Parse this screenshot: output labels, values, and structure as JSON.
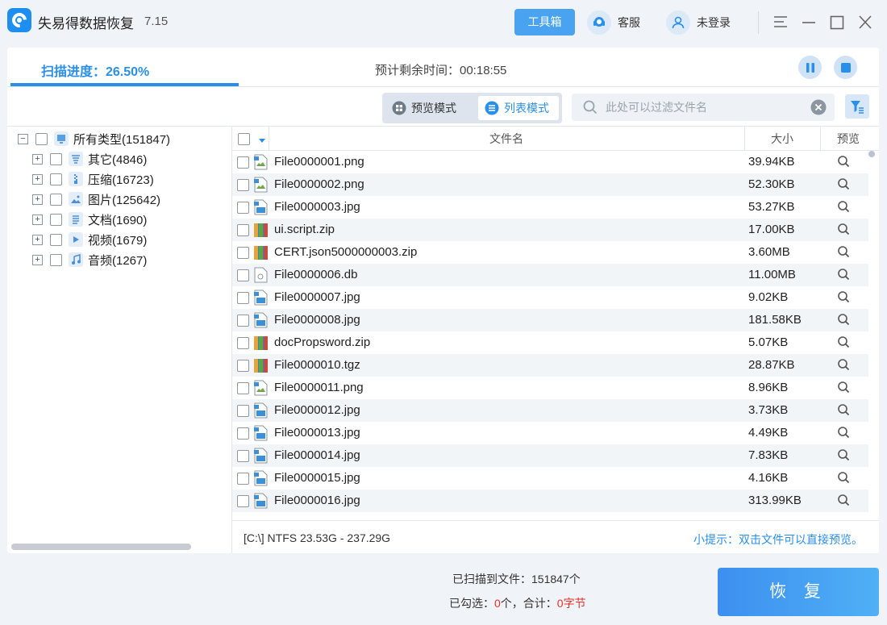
{
  "app": {
    "title": "失易得数据恢复",
    "version": "7.15"
  },
  "titlebar": {
    "toolbox_label": "工具箱",
    "service_label": "客服",
    "login_label": "未登录"
  },
  "scan": {
    "progress_label": "扫描进度：26.50%",
    "progress_value": 0.265,
    "eta_label": "预计剩余时间：00:18:55"
  },
  "modes": {
    "preview_label": "预览模式",
    "list_label": "列表模式",
    "active": "list"
  },
  "search": {
    "placeholder": "此处可以过滤文件名",
    "value": ""
  },
  "tree": {
    "root": {
      "label": "所有类型(151847)"
    },
    "children": [
      {
        "label": "其它(4846)",
        "icon": "other-icon"
      },
      {
        "label": "压缩(16723)",
        "icon": "zip-icon"
      },
      {
        "label": "图片(125642)",
        "icon": "image-icon"
      },
      {
        "label": "文档(1690)",
        "icon": "document-icon"
      },
      {
        "label": "视频(1679)",
        "icon": "video-icon"
      },
      {
        "label": "音频(1267)",
        "icon": "audio-icon"
      }
    ]
  },
  "table": {
    "headers": {
      "name": "文件名",
      "size": "大小",
      "preview": "预览"
    },
    "rows": [
      {
        "name": "File0000001.png",
        "size": "39.94KB",
        "type": "png"
      },
      {
        "name": "File0000002.png",
        "size": "52.30KB",
        "type": "png"
      },
      {
        "name": "File0000003.jpg",
        "size": "53.27KB",
        "type": "jpg"
      },
      {
        "name": "ui.script.zip",
        "size": "17.00KB",
        "type": "zip"
      },
      {
        "name": "CERT.json5000000003.zip",
        "size": "3.60MB",
        "type": "zip"
      },
      {
        "name": "File0000006.db",
        "size": "11.00MB",
        "type": "db"
      },
      {
        "name": "File0000007.jpg",
        "size": "9.02KB",
        "type": "jpg"
      },
      {
        "name": "File0000008.jpg",
        "size": "181.58KB",
        "type": "jpg"
      },
      {
        "name": "docPropsword.zip",
        "size": "5.07KB",
        "type": "zip"
      },
      {
        "name": "File0000010.tgz",
        "size": "28.87KB",
        "type": "zip"
      },
      {
        "name": "File0000011.png",
        "size": "8.96KB",
        "type": "png"
      },
      {
        "name": "File0000012.jpg",
        "size": "3.73KB",
        "type": "jpg"
      },
      {
        "name": "File0000013.jpg",
        "size": "4.49KB",
        "type": "jpg"
      },
      {
        "name": "File0000014.jpg",
        "size": "7.83KB",
        "type": "jpg"
      },
      {
        "name": "File0000015.jpg",
        "size": "4.16KB",
        "type": "jpg"
      },
      {
        "name": "File0000016.jpg",
        "size": "313.99KB",
        "type": "jpg"
      }
    ]
  },
  "status": {
    "disk_info": "[C:\\] NTFS 23.53G - 237.29G",
    "tip": "小提示：双击文件可以直接预览。"
  },
  "footer": {
    "found_label": "已扫描到文件：151847个",
    "selected_prefix": "已勾选：",
    "selected_count": "0",
    "selected_mid": "个，合计：",
    "selected_bytes": "0字节",
    "recover_label": "恢 复"
  },
  "colors": {
    "accent": "#2a8fe8",
    "highlight_red": "#e8302a"
  }
}
